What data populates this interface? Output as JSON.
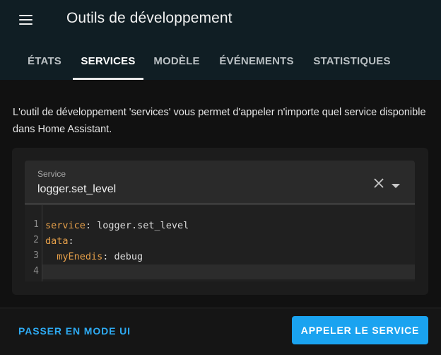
{
  "app": {
    "title": "Outils de développement"
  },
  "tabs": [
    {
      "label": "ÉTATS",
      "active": false
    },
    {
      "label": "SERVICES",
      "active": true
    },
    {
      "label": "MODÈLE",
      "active": false
    },
    {
      "label": "ÉVÉNEMENTS",
      "active": false
    },
    {
      "label": "STATISTIQUES",
      "active": false
    }
  ],
  "description": "L'outil de développement 'services' vous permet d'appeler n'importe quel service disponible dans Home Assistant.",
  "service_select": {
    "label": "Service",
    "value": "logger.set_level",
    "clear_icon": "close-icon",
    "caret_icon": "caret-down-icon"
  },
  "editor": {
    "line_numbers": [
      "1",
      "2",
      "3",
      "4"
    ],
    "lines": [
      {
        "key": "service",
        "sep": ":",
        "value": " logger.set_level"
      },
      {
        "key": "data",
        "sep": ":",
        "value": ""
      },
      {
        "key": "  myEnedis",
        "sep": ":",
        "value": " debug"
      },
      {
        "key": "",
        "sep": "",
        "value": ""
      }
    ]
  },
  "footer": {
    "mode_button": "PASSER EN MODE UI",
    "call_button": "APPELER LE SERVICE"
  },
  "colors": {
    "accent": "#1aa3f0",
    "yaml_key": "#e8a14a",
    "header_bg": "#101e24"
  }
}
